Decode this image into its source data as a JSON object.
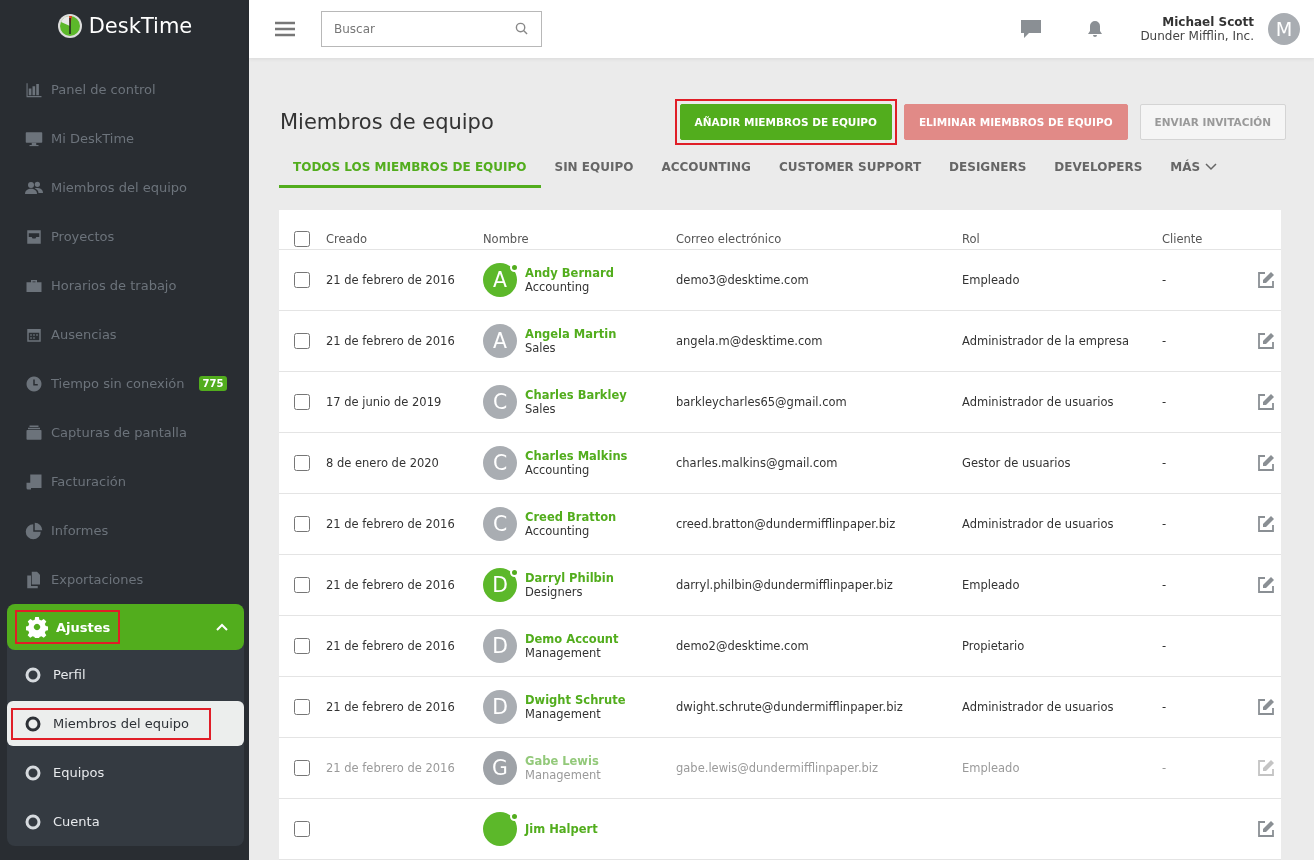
{
  "brand": {
    "name": "DeskTime"
  },
  "sidebar": {
    "items": [
      {
        "label": "Panel de control"
      },
      {
        "label": "Mi DeskTime"
      },
      {
        "label": "Miembros del equipo"
      },
      {
        "label": "Proyectos"
      },
      {
        "label": "Horarios de trabajo"
      },
      {
        "label": "Ausencias"
      },
      {
        "label": "Tiempo sin conexión",
        "badge": "775"
      },
      {
        "label": "Capturas de pantalla"
      },
      {
        "label": "Facturación"
      },
      {
        "label": "Informes"
      },
      {
        "label": "Exportaciones"
      }
    ],
    "settings": {
      "label": "Ajustes",
      "expanded": true,
      "highlighted": true,
      "children": [
        {
          "label": "Perfil",
          "selected": false,
          "highlighted": false
        },
        {
          "label": "Miembros del equipo",
          "selected": true,
          "highlighted": true
        },
        {
          "label": "Equipos",
          "selected": false,
          "highlighted": false
        },
        {
          "label": "Cuenta",
          "selected": false,
          "highlighted": false
        }
      ]
    }
  },
  "topbar": {
    "search": {
      "placeholder": "Buscar"
    },
    "user": {
      "name": "Michael Scott",
      "company": "Dunder Mifflin, Inc.",
      "initial": "M"
    }
  },
  "page": {
    "title": "Miembros de equipo",
    "buttons": [
      {
        "label": "AÑADIR MIEMBROS DE EQUIPO",
        "kind": "primary",
        "highlighted": true
      },
      {
        "label": "ELIMINAR MIEMBROS DE EQUIPO",
        "kind": "danger",
        "highlighted": false
      },
      {
        "label": "ENVIAR INVITACIÓN",
        "kind": "plain",
        "highlighted": false
      }
    ],
    "tabs": [
      {
        "label": "TODOS LOS MIEMBROS DE EQUIPO",
        "selected": true
      },
      {
        "label": "SIN EQUIPO",
        "selected": false
      },
      {
        "label": "ACCOUNTING",
        "selected": false
      },
      {
        "label": "CUSTOMER SUPPORT",
        "selected": false
      },
      {
        "label": "DESIGNERS",
        "selected": false
      },
      {
        "label": "DEVELOPERS",
        "selected": false
      },
      {
        "label": "MÁS",
        "selected": false,
        "kind": "dropdown"
      }
    ]
  },
  "table": {
    "select_all": {
      "checked": false
    },
    "columns": [
      "Creado",
      "Nombre",
      "Correo electrónico",
      "Rol",
      "Cliente"
    ],
    "rows": [
      {
        "created": "21 de febrero de 2016",
        "initial": "A",
        "name": "Andy Bernard",
        "team": "Accounting",
        "email": "demo3@desktime.com",
        "role": "Empleado",
        "client": "-",
        "online": true,
        "disabled": false,
        "actions": true,
        "checked": false
      },
      {
        "created": "21 de febrero de 2016",
        "initial": "A",
        "name": "Angela Martin",
        "team": "Sales",
        "email": "angela.m@desktime.com",
        "role": "Administrador de la empresa",
        "client": "-",
        "online": false,
        "disabled": false,
        "actions": true,
        "checked": false
      },
      {
        "created": "17 de junio de 2019",
        "initial": "C",
        "name": "Charles Barkley",
        "team": "Sales",
        "email": "barkleycharles65@gmail.com",
        "role": "Administrador de usuarios",
        "client": "-",
        "online": false,
        "disabled": false,
        "actions": true,
        "checked": false
      },
      {
        "created": "8 de enero de 2020",
        "initial": "C",
        "name": "Charles Malkins",
        "team": "Accounting",
        "email": "charles.malkins@gmail.com",
        "role": "Gestor de usuarios",
        "client": "-",
        "online": false,
        "disabled": false,
        "actions": true,
        "checked": false
      },
      {
        "created": "21 de febrero de 2016",
        "initial": "C",
        "name": "Creed Bratton",
        "team": "Accounting",
        "email": "creed.bratton@dundermifflinpaper.biz",
        "role": "Administrador de usuarios",
        "client": "-",
        "online": false,
        "disabled": false,
        "actions": true,
        "checked": false
      },
      {
        "created": "21 de febrero de 2016",
        "initial": "D",
        "name": "Darryl Philbin",
        "team": "Designers",
        "email": "darryl.philbin@dundermifflinpaper.biz",
        "role": "Empleado",
        "client": "-",
        "online": true,
        "disabled": false,
        "actions": true,
        "checked": false
      },
      {
        "created": "21 de febrero de 2016",
        "initial": "D",
        "name": "Demo Account",
        "team": "Management",
        "email": "demo2@desktime.com",
        "role": "Propietario",
        "client": "-",
        "online": false,
        "disabled": false,
        "actions": false,
        "checked": false
      },
      {
        "created": "21 de febrero de 2016",
        "initial": "D",
        "name": "Dwight Schrute",
        "team": "Management",
        "email": "dwight.schrute@dundermifflinpaper.biz",
        "role": "Administrador de usuarios",
        "client": "-",
        "online": false,
        "disabled": false,
        "actions": true,
        "checked": false
      },
      {
        "created": "21 de febrero de 2016",
        "initial": "G",
        "name": "Gabe Lewis",
        "team": "Management",
        "email": "gabe.lewis@dundermifflinpaper.biz",
        "role": "Empleado",
        "client": "-",
        "online": false,
        "disabled": true,
        "actions": true,
        "checked": false
      },
      {
        "name": "Jim Halpert",
        "online": true,
        "disabled": false,
        "actions": true,
        "checked": false
      }
    ]
  }
}
